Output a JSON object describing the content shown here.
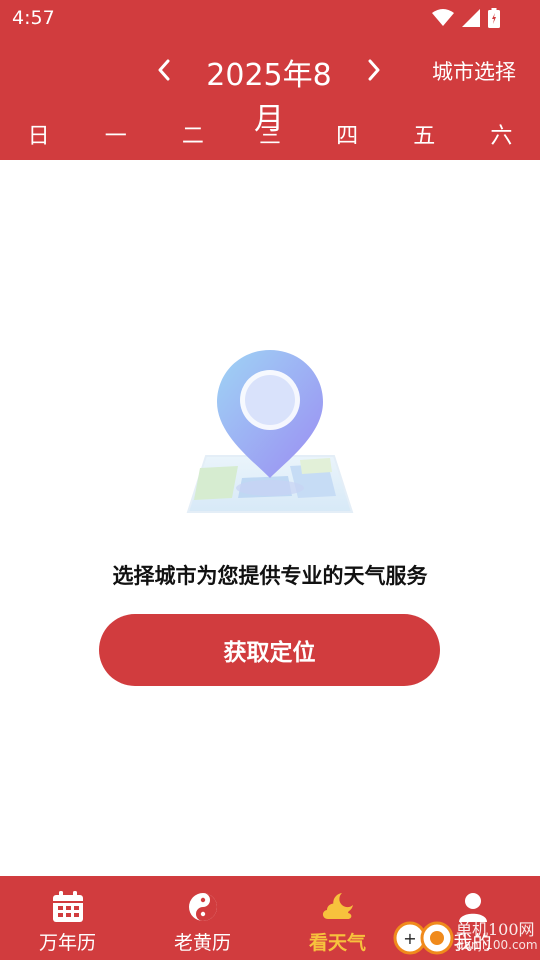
{
  "status_bar": {
    "time": "4:57"
  },
  "header": {
    "month_title": "2025年8月",
    "city_select_label": "城市选择",
    "weekdays": [
      "日",
      "一",
      "二",
      "三",
      "四",
      "五",
      "六"
    ]
  },
  "main": {
    "message": "选择城市为您提供专业的天气服务",
    "locate_button_label": "获取定位"
  },
  "tabbar": {
    "tabs": [
      {
        "label": "万年历",
        "icon": "calendar-icon"
      },
      {
        "label": "老黄历",
        "icon": "yin-yang-icon"
      },
      {
        "label": "看天气",
        "icon": "weather-icon",
        "active": true
      },
      {
        "label": "我的",
        "icon": "user-icon"
      }
    ]
  },
  "watermark": {
    "text": "单机100网",
    "sub": "danji100.com"
  },
  "colors": {
    "brand_red": "#d13c3e",
    "active_tab": "#f7c23d"
  }
}
